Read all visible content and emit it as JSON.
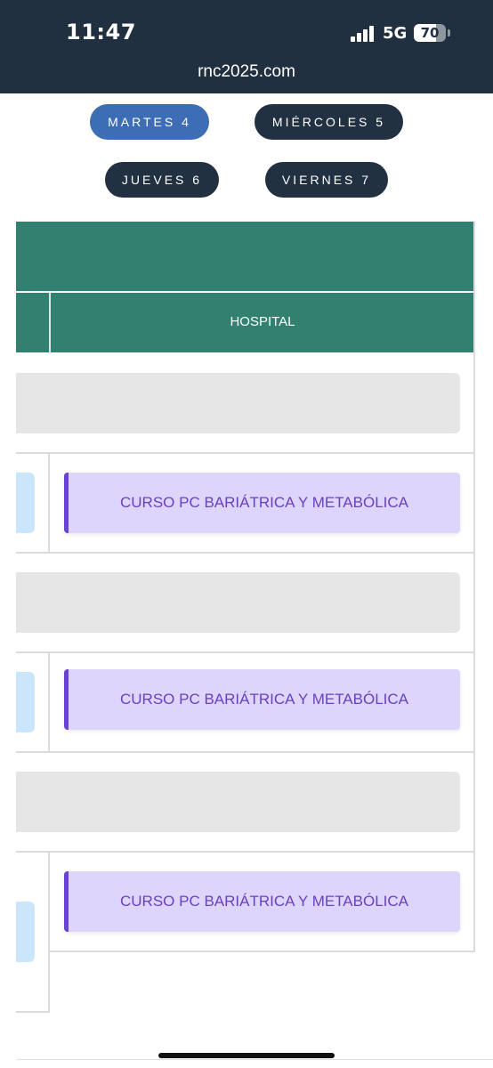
{
  "status_bar": {
    "time": "11:47",
    "network": "5G",
    "battery": "70",
    "battery_level": 0.7,
    "url": "rnc2025.com"
  },
  "days": {
    "tue": "MARTES 4",
    "wed": "MIÉRCOLES 5",
    "thu": "JUEVES 6",
    "fri": "VIERNES 7",
    "active": "MARTES 4"
  },
  "table": {
    "column_header": "HOSPITAL",
    "events": [
      "CURSO PC BARIÁTRICA Y METABÓLICA",
      "CURSO PC BARIÁTRICA Y METABÓLICA",
      "CURSO PC BARIÁTRICA Y METABÓLICA"
    ]
  },
  "colors": {
    "status_bg": "#213040",
    "tab_active": "#3d6db5",
    "tab_inactive": "#223142",
    "header_teal": "#318070",
    "event_bg": "#ddd5fb",
    "event_accent": "#6a44cc",
    "event_text": "#6a40c2"
  }
}
